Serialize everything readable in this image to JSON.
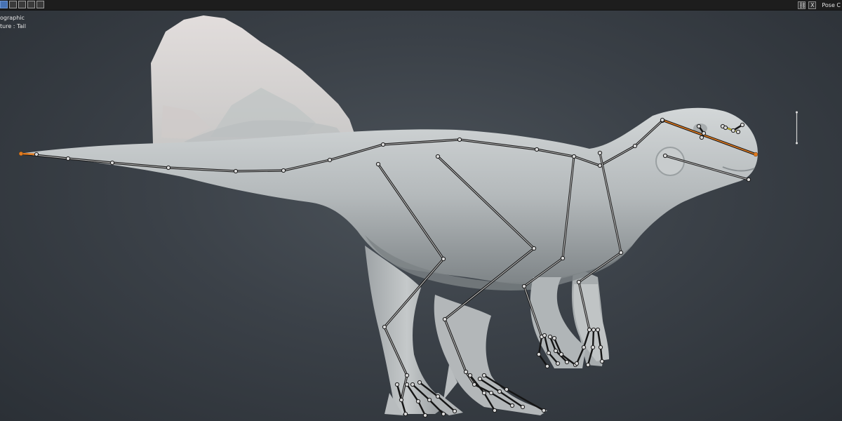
{
  "header": {
    "pose_label": "Pose C",
    "close_glyph": "X",
    "overlay_icon": "overlay-icon",
    "close_icon": "close-icon"
  },
  "mode_icons": [
    "solid-mode-icon",
    "wireframe-mode-icon",
    "material-mode-icon",
    "render-mode-icon",
    "viewport-shading-icon"
  ],
  "viewport": {
    "view_label": "ographic",
    "active_label": "ture : Tail"
  },
  "colors": {
    "bone": "#1a1a1a",
    "bone_active": "#e07a1f",
    "joint": "#d9d9d9",
    "mesh": "#b7bcbd",
    "sail": "#d8d2d0",
    "background": "#3b4148"
  }
}
